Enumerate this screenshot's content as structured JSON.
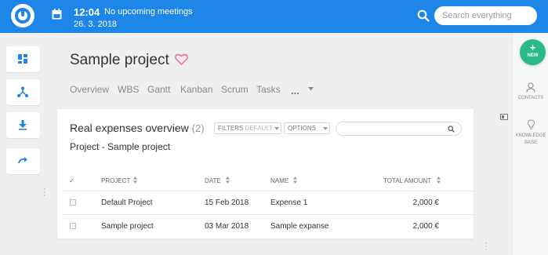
{
  "topbar": {
    "time": "12:04",
    "meetings": "No upcoming meetings",
    "date": "26. 3. 2018",
    "search_placeholder": "Search everything",
    "color": "#1e86e8"
  },
  "left_sidebar": {
    "buttons": [
      {
        "icon": "dashboard-icon"
      },
      {
        "icon": "hierarchy-icon"
      },
      {
        "icon": "download-icon"
      },
      {
        "icon": "redo-icon"
      }
    ]
  },
  "right_sidebar": {
    "new_label": "NEW",
    "new_color": "#27b989",
    "contacts_label": "CONTACTS",
    "knowledge_label_1": "KNOWLEDGE",
    "knowledge_label_2": "BASE"
  },
  "project": {
    "title": "Sample project",
    "favorite_icon": "heart-icon",
    "tabs": [
      "Overview",
      "WBS",
      "Gantt",
      "Kanban",
      "Scrum",
      "Tasks"
    ],
    "more_label": "..."
  },
  "card": {
    "title": "Real expenses overview",
    "count": "(2)",
    "filters_label": "FILTERS",
    "filters_value": "DEFAULT",
    "options_label": "OPTIONS",
    "subtitle": "Project - Sample project",
    "columns": {
      "check": "✓",
      "project": "PROJECT",
      "date": "DATE",
      "name": "NAME",
      "total": "TOTAL AMOUNT"
    },
    "rows": [
      {
        "project": "Default Project",
        "date": "15 Feb 2018",
        "name": "Expense 1",
        "total": "2,000 €"
      },
      {
        "project": "Sample project",
        "date": "03 Mar 2018",
        "name": "Sample expanse",
        "total": "2,000 €"
      }
    ]
  }
}
